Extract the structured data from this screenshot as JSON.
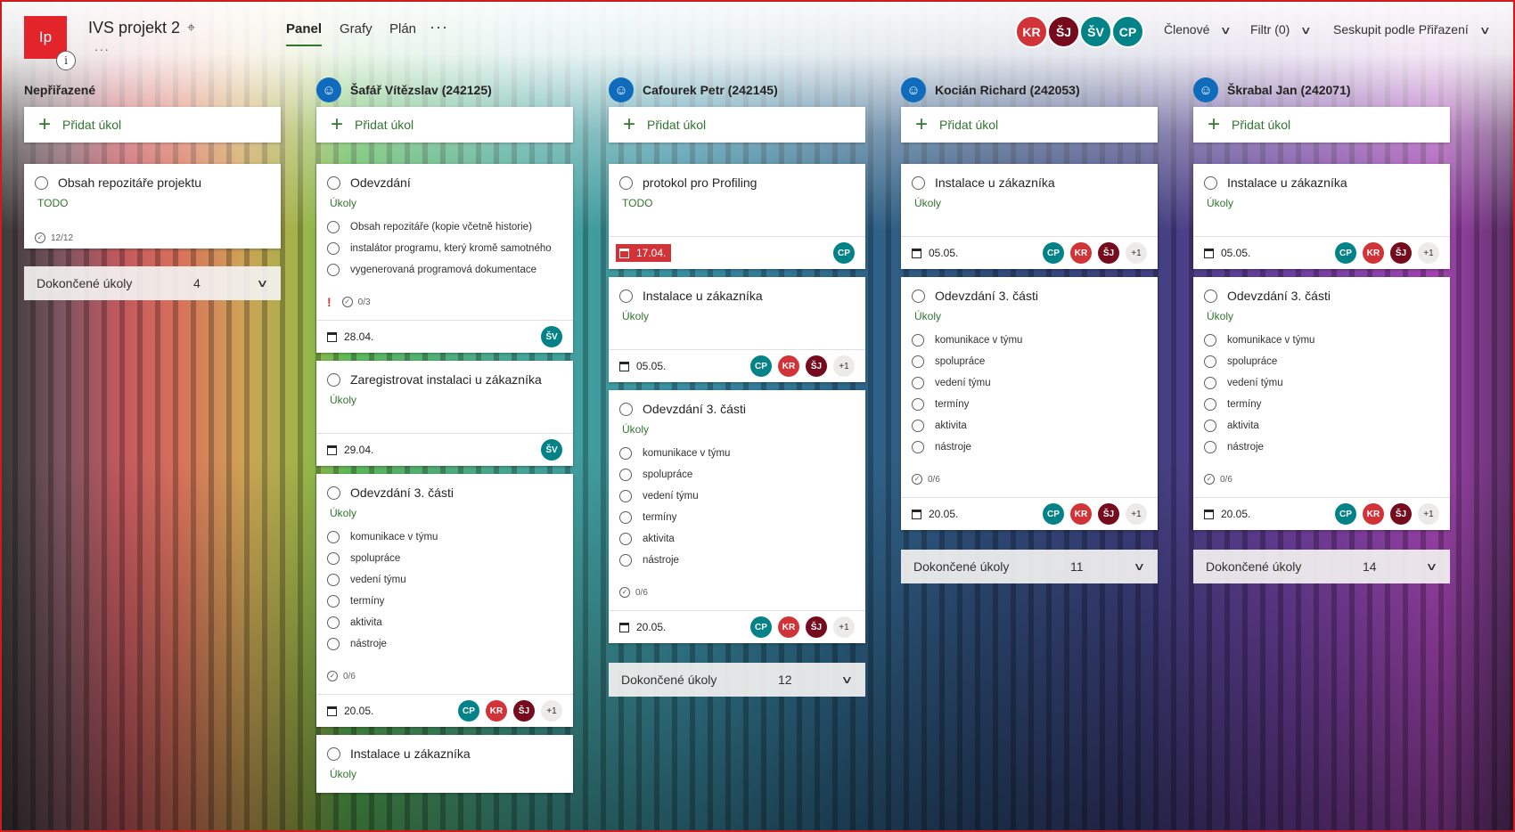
{
  "app": {
    "logo_text": "Ip",
    "logo_info": "i",
    "project_title": "IVS projekt 2",
    "project_more": "...",
    "tabs": [
      "Panel",
      "Grafy",
      "Plán"
    ],
    "tabs_more": "···",
    "active_tab": "Panel"
  },
  "members": [
    {
      "initials": "KR",
      "color": "#d13438"
    },
    {
      "initials": "ŠJ",
      "color": "#750b1c"
    },
    {
      "initials": "ŠV",
      "color": "#038387"
    },
    {
      "initials": "CP",
      "color": "#038387"
    }
  ],
  "header_buttons": {
    "members": "Členové",
    "filter": "Filtr (0)",
    "group_by": "Seskupit podle Přiřazení"
  },
  "avatar_colors": {
    "CP": "#038387",
    "KR": "#d13438",
    "ŠJ": "#750b1c",
    "ŠV": "#038387"
  },
  "add_task_label": "Přidat úkol",
  "columns": [
    {
      "title": "Nepřiřazené",
      "cards": [
        {
          "title": "Obsah repozitáře projektu",
          "label": "TODO",
          "checklist": "12/12"
        }
      ],
      "done": {
        "label": "Dokončené úkoly",
        "count": "4"
      }
    },
    {
      "title": "Šafář Vítězslav (242125)",
      "cards": [
        {
          "title": "Odevzdání",
          "label": "Úkoly",
          "items": [
            "Obsah repozitáře (kopie včetně historie)",
            "instalátor programu, který kromě samotného",
            "vygenerovaná programová dokumentace"
          ],
          "checklist": "0/3",
          "priority": "!",
          "due": "28.04.",
          "avatars": [
            "ŠV"
          ]
        },
        {
          "title": "Zaregistrovat instalaci u zákazníka",
          "label": "Úkoly",
          "due": "29.04.",
          "avatars": [
            "ŠV"
          ]
        },
        {
          "title": "Odevzdání 3. části",
          "label": "Úkoly",
          "items": [
            "komunikace v týmu",
            "spolupráce",
            "vedení týmu",
            "termíny",
            "aktivita",
            "nástroje"
          ],
          "checklist": "0/6",
          "due": "20.05.",
          "avatars": [
            "CP",
            "KR",
            "ŠJ"
          ],
          "more": "+1"
        },
        {
          "title": "Instalace u zákazníka",
          "label": "Úkoly"
        }
      ]
    },
    {
      "title": "Cafourek Petr (242145)",
      "cards": [
        {
          "title": "protokol pro Profiling",
          "label": "TODO",
          "due": "17.04.",
          "overdue": true,
          "avatars": [
            "CP"
          ]
        },
        {
          "title": "Instalace u zákazníka",
          "label": "Úkoly",
          "due": "05.05.",
          "avatars": [
            "CP",
            "KR",
            "ŠJ"
          ],
          "more": "+1"
        },
        {
          "title": "Odevzdání 3. části",
          "label": "Úkoly",
          "items": [
            "komunikace v týmu",
            "spolupráce",
            "vedení týmu",
            "termíny",
            "aktivita",
            "nástroje"
          ],
          "checklist": "0/6",
          "due": "20.05.",
          "avatars": [
            "CP",
            "KR",
            "ŠJ"
          ],
          "more": "+1"
        }
      ],
      "done": {
        "label": "Dokončené úkoly",
        "count": "12"
      }
    },
    {
      "title": "Kocián Richard (242053)",
      "cards": [
        {
          "title": "Instalace u zákazníka",
          "label": "Úkoly",
          "due": "05.05.",
          "avatars": [
            "CP",
            "KR",
            "ŠJ"
          ],
          "more": "+1"
        },
        {
          "title": "Odevzdání 3. části",
          "label": "Úkoly",
          "items": [
            "komunikace v týmu",
            "spolupráce",
            "vedení týmu",
            "termíny",
            "aktivita",
            "nástroje"
          ],
          "checklist": "0/6",
          "due": "20.05.",
          "avatars": [
            "CP",
            "KR",
            "ŠJ"
          ],
          "more": "+1"
        }
      ],
      "done": {
        "label": "Dokončené úkoly",
        "count": "11"
      }
    },
    {
      "title": "Škrabal Jan (242071)",
      "cards": [
        {
          "title": "Instalace u zákazníka",
          "label": "Úkoly",
          "due": "05.05.",
          "avatars": [
            "CP",
            "KR",
            "ŠJ"
          ],
          "more": "+1"
        },
        {
          "title": "Odevzdání 3. části",
          "label": "Úkoly",
          "items": [
            "komunikace v týmu",
            "spolupráce",
            "vedení týmu",
            "termíny",
            "aktivita",
            "nástroje"
          ],
          "checklist": "0/6",
          "due": "20.05.",
          "avatars": [
            "CP",
            "KR",
            "ŠJ"
          ],
          "more": "+1"
        }
      ],
      "done": {
        "label": "Dokončené úkoly",
        "count": "14"
      }
    }
  ]
}
